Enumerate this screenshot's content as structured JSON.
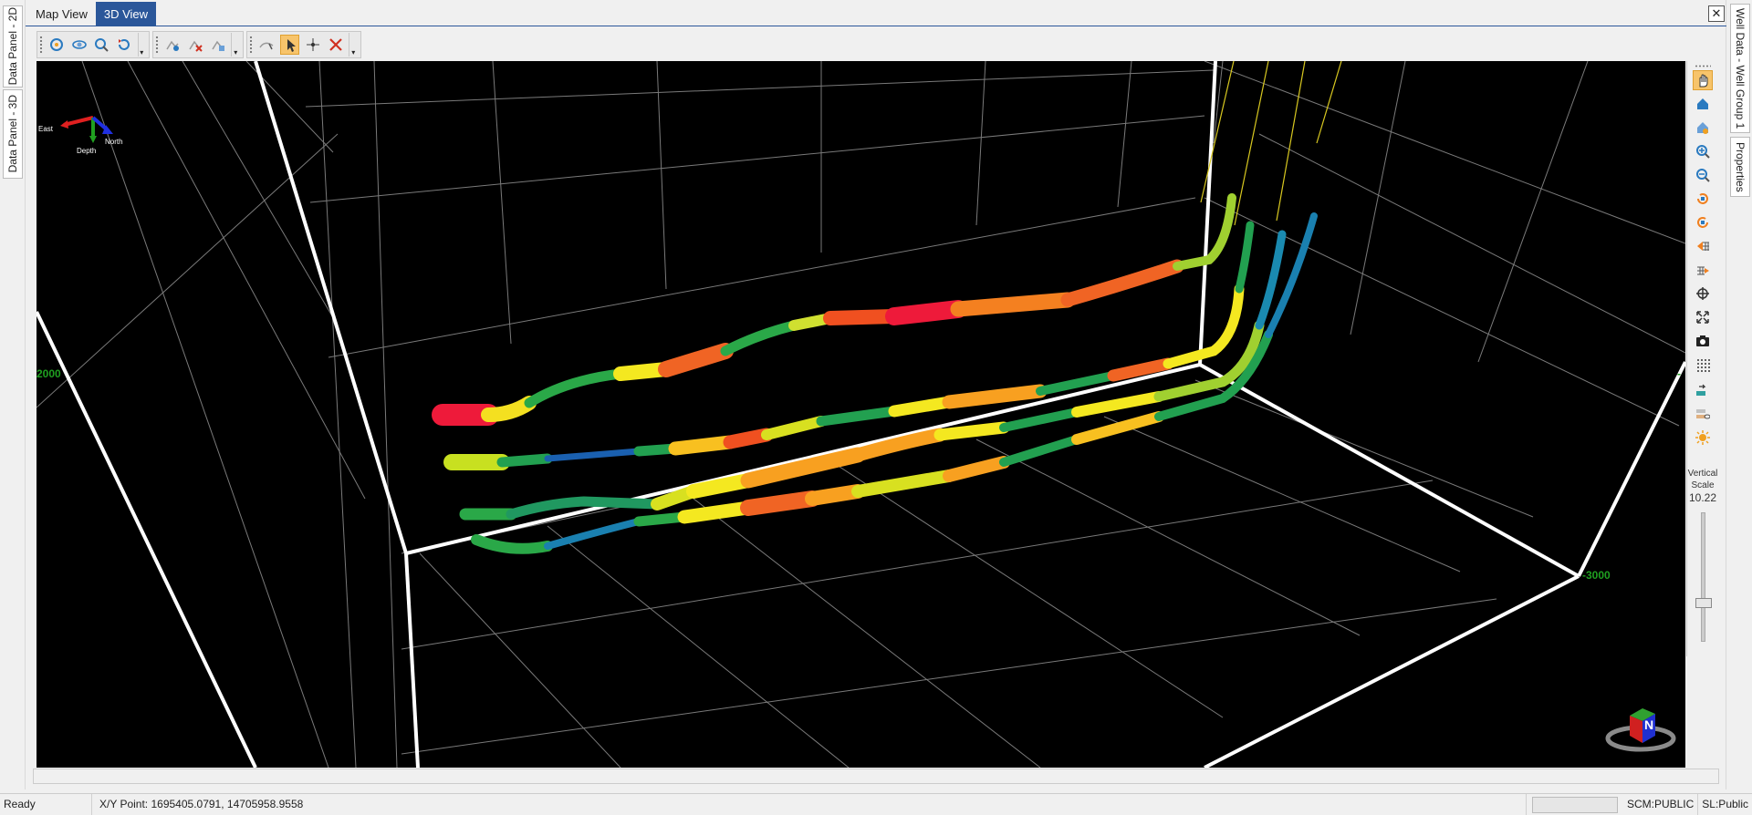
{
  "left_panel": {
    "tabs": [
      {
        "label": "Data Panel - 2D"
      },
      {
        "label": "Data Panel - 3D"
      }
    ]
  },
  "right_panel": {
    "tabs": [
      {
        "label": "Well Data - Well Group 1"
      },
      {
        "label": "Properties"
      }
    ]
  },
  "view_tabs": [
    {
      "label": "Map View",
      "active": false
    },
    {
      "label": "3D View",
      "active": true
    }
  ],
  "close_glyph": "✕",
  "viewport": {
    "background": "#000000",
    "axis_labels": {
      "depth_left": "2000",
      "depth_right": "-3000",
      "right_edge": "-"
    },
    "compass": {
      "east": "East",
      "north": "North",
      "depth": "Depth"
    },
    "nav_cube": {
      "label": "N"
    }
  },
  "vertical_scale": {
    "label_line1": "Vertical",
    "label_line2": "Scale",
    "value": "10.22"
  },
  "statusbar": {
    "ready": "Ready",
    "xy_point": "X/Y Point: 1695405.0791, 14705958.9558",
    "scm": "SCM:PUBLIC",
    "sl": "SL:Public"
  },
  "colors": {
    "accent": "#2b579a",
    "grid": "#8a8a8a",
    "axis_text": "#1fa020",
    "highlight": "#f7c46b"
  }
}
